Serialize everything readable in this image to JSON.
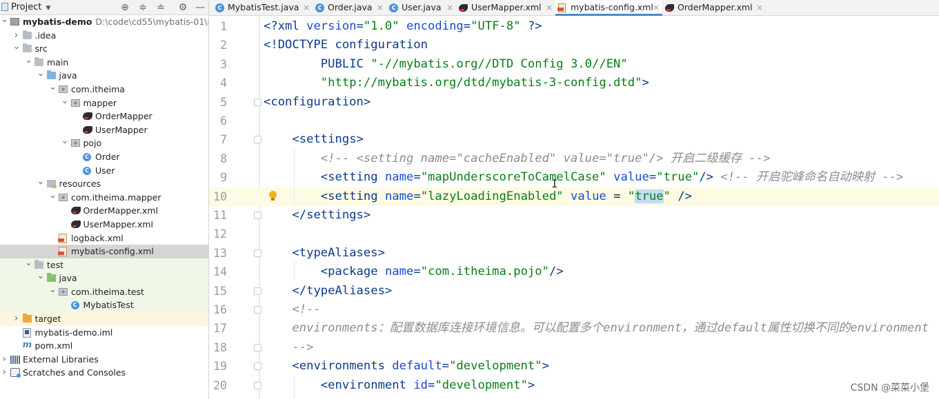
{
  "project_pane": {
    "title": "Project",
    "toolbar_icons": [
      "crosshair-icon",
      "expand-all-icon",
      "collapse-all-icon",
      "gear-icon",
      "minimize-icon"
    ],
    "tree": [
      {
        "label": "mybatis-demo",
        "path": "D:\\code\\cd55\\mybatis-01\\myba",
        "icon": "module-folder",
        "level": 0,
        "expanded": true
      },
      {
        "label": ".idea",
        "icon": "folder",
        "level": 1,
        "expanded": false
      },
      {
        "label": "src",
        "icon": "folder",
        "level": 1,
        "expanded": true
      },
      {
        "label": "main",
        "icon": "folder",
        "level": 2,
        "expanded": true
      },
      {
        "label": "java",
        "icon": "source-folder",
        "level": 3,
        "expanded": true
      },
      {
        "label": "com.itheima",
        "icon": "package",
        "level": 4,
        "expanded": true
      },
      {
        "label": "mapper",
        "icon": "package",
        "level": 5,
        "expanded": true
      },
      {
        "label": "OrderMapper",
        "icon": "mybatis-interface",
        "level": 6
      },
      {
        "label": "UserMapper",
        "icon": "mybatis-interface",
        "level": 6
      },
      {
        "label": "pojo",
        "icon": "package",
        "level": 5,
        "expanded": true
      },
      {
        "label": "Order",
        "icon": "class",
        "level": 6
      },
      {
        "label": "User",
        "icon": "class",
        "level": 6
      },
      {
        "label": "resources",
        "icon": "resources-folder",
        "level": 3,
        "expanded": true
      },
      {
        "label": "com.itheima.mapper",
        "icon": "package",
        "level": 4,
        "expanded": true
      },
      {
        "label": "OrderMapper.xml",
        "icon": "mybatis-xml",
        "level": 5
      },
      {
        "label": "UserMapper.xml",
        "icon": "mybatis-xml",
        "level": 5
      },
      {
        "label": "logback.xml",
        "icon": "xml-file",
        "level": 4
      },
      {
        "label": "mybatis-config.xml",
        "icon": "xml-file",
        "level": 4,
        "selected": true
      },
      {
        "label": "test",
        "icon": "folder",
        "level": 2,
        "expanded": true,
        "tint": "test"
      },
      {
        "label": "java",
        "icon": "test-folder",
        "level": 3,
        "expanded": true,
        "tint": "test"
      },
      {
        "label": "com.itheima.test",
        "icon": "package",
        "level": 4,
        "expanded": true,
        "tint": "test"
      },
      {
        "label": "MybatisTest",
        "icon": "class",
        "level": 5,
        "tint": "test"
      },
      {
        "label": "target",
        "icon": "target-folder",
        "level": 1,
        "expanded": false,
        "tint": "target"
      },
      {
        "label": "mybatis-demo.iml",
        "icon": "iml-file",
        "level": 1
      },
      {
        "label": "pom.xml",
        "icon": "maven-file",
        "level": 1
      },
      {
        "label": "External Libraries",
        "icon": "libraries",
        "level": 0,
        "expanded": false
      },
      {
        "label": "Scratches and Consoles",
        "icon": "scratches",
        "level": 0,
        "expanded": false
      }
    ]
  },
  "tabs": [
    {
      "label": "MybatisTest.java",
      "icon": "class",
      "active": false
    },
    {
      "label": "Order.java",
      "icon": "class",
      "active": false
    },
    {
      "label": "User.java",
      "icon": "class",
      "active": false
    },
    {
      "label": "UserMapper.xml",
      "icon": "mybatis-xml",
      "active": false
    },
    {
      "label": "mybatis-config.xml",
      "icon": "xml-file",
      "active": true
    },
    {
      "label": "OrderMapper.xml",
      "icon": "mybatis-xml",
      "active": false
    }
  ],
  "editor": {
    "caret_line": 10,
    "lines": [
      {
        "n": "1",
        "tokens": [
          [
            "pi",
            "<?xml "
          ],
          [
            "attr",
            "version"
          ],
          [
            "pi",
            "="
          ],
          [
            "val",
            "\"1.0\""
          ],
          [
            "plain",
            " "
          ],
          [
            "attr",
            "encoding"
          ],
          [
            "pi",
            "="
          ],
          [
            "val",
            "\"UTF-8\""
          ],
          [
            "pi",
            " ?>"
          ]
        ]
      },
      {
        "n": "2",
        "tokens": [
          [
            "tag",
            "<!DOCTYPE configuration"
          ]
        ]
      },
      {
        "n": "3",
        "tokens": [
          [
            "plain",
            "        "
          ],
          [
            "tag",
            "PUBLIC "
          ],
          [
            "val",
            "\"-//mybatis.org//DTD Config 3.0//EN\""
          ]
        ]
      },
      {
        "n": "4",
        "tokens": [
          [
            "plain",
            "        "
          ],
          [
            "val",
            "\"http://mybatis.org/dtd/mybatis-3-config.dtd\""
          ],
          [
            "tag",
            ">"
          ]
        ]
      },
      {
        "n": "5",
        "tokens": [
          [
            "tag",
            "<configuration>"
          ]
        ]
      },
      {
        "n": "6",
        "tokens": []
      },
      {
        "n": "7",
        "tokens": [
          [
            "plain",
            "    "
          ],
          [
            "tag",
            "<settings>"
          ]
        ]
      },
      {
        "n": "8",
        "tokens": [
          [
            "plain",
            "        "
          ],
          [
            "cmt",
            "<!-- <setting name=\"cacheEnabled\" value=\"true\"/> 开启二级缓存 -->"
          ]
        ]
      },
      {
        "n": "9",
        "tokens": [
          [
            "plain",
            "        "
          ],
          [
            "tag",
            "<setting "
          ],
          [
            "attr",
            "name"
          ],
          [
            "tag",
            "="
          ],
          [
            "val",
            "\"mapUnderscoreToCamelCase\""
          ],
          [
            "plain",
            " "
          ],
          [
            "attr",
            "value"
          ],
          [
            "tag",
            "="
          ],
          [
            "val",
            "\"true\""
          ],
          [
            "tag",
            "/>"
          ],
          [
            "plain",
            " "
          ],
          [
            "cmt",
            "<!-- 开启驼峰命名自动映射 -->"
          ]
        ]
      },
      {
        "n": "10",
        "tokens": [
          [
            "plain",
            "        "
          ],
          [
            "tag",
            "<setting "
          ],
          [
            "attr",
            "name"
          ],
          [
            "tag",
            "="
          ],
          [
            "val",
            "\"lazyLoadingEnabled\""
          ],
          [
            "plain",
            " "
          ],
          [
            "attr",
            "value"
          ],
          [
            "plain",
            " = "
          ],
          [
            "val",
            "\""
          ],
          [
            "sel",
            "true"
          ],
          [
            "val",
            "\""
          ],
          [
            "plain",
            " "
          ],
          [
            "tag",
            "/>"
          ]
        ]
      },
      {
        "n": "11",
        "tokens": [
          [
            "plain",
            "    "
          ],
          [
            "tag",
            "</settings>"
          ]
        ]
      },
      {
        "n": "12",
        "tokens": []
      },
      {
        "n": "13",
        "tokens": [
          [
            "plain",
            "    "
          ],
          [
            "tag",
            "<typeAliases>"
          ]
        ]
      },
      {
        "n": "14",
        "tokens": [
          [
            "plain",
            "        "
          ],
          [
            "tag",
            "<package "
          ],
          [
            "attr",
            "name"
          ],
          [
            "tag",
            "="
          ],
          [
            "val",
            "\"com.itheima.pojo\""
          ],
          [
            "tag",
            "/>"
          ]
        ]
      },
      {
        "n": "15",
        "tokens": [
          [
            "plain",
            "    "
          ],
          [
            "tag",
            "</typeAliases>"
          ]
        ]
      },
      {
        "n": "16",
        "tokens": [
          [
            "plain",
            "    "
          ],
          [
            "cmt",
            "<!--"
          ]
        ]
      },
      {
        "n": "17",
        "tokens": [
          [
            "plain",
            "    "
          ],
          [
            "cmt",
            "environments：配置数据库连接环境信息。可以配置多个environment，通过default属性切换不同的environment"
          ]
        ]
      },
      {
        "n": "18",
        "tokens": [
          [
            "plain",
            "    "
          ],
          [
            "cmt",
            "-->"
          ]
        ]
      },
      {
        "n": "19",
        "tokens": [
          [
            "plain",
            "    "
          ],
          [
            "tag",
            "<environments "
          ],
          [
            "attr",
            "default"
          ],
          [
            "tag",
            "="
          ],
          [
            "val",
            "\"development\""
          ],
          [
            "tag",
            ">"
          ]
        ]
      },
      {
        "n": "20",
        "tokens": [
          [
            "plain",
            "        "
          ],
          [
            "tag",
            "<environment "
          ],
          [
            "attr",
            "id"
          ],
          [
            "tag",
            "="
          ],
          [
            "val",
            "\"development\""
          ],
          [
            "tag",
            ">"
          ]
        ]
      }
    ]
  },
  "watermark": "CSDN @菜菜小堡"
}
